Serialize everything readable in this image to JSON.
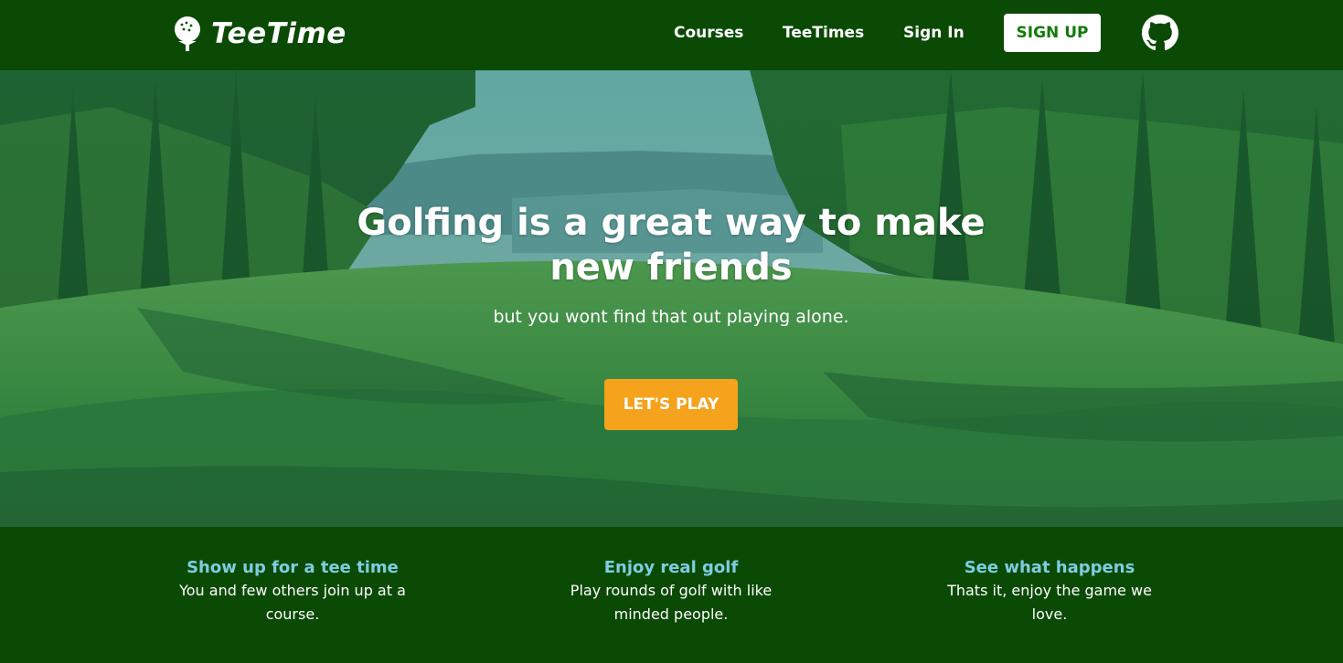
{
  "brand": {
    "name": "TeeTime",
    "icon": "golf-ball-on-tee-icon"
  },
  "nav": {
    "links": [
      "Courses",
      "TeeTimes",
      "Sign In"
    ],
    "signup_label": "SIGN UP",
    "github_icon": "github-icon"
  },
  "hero": {
    "title": "Golfing is a great way to make new friends",
    "subtitle": "but you wont find that out playing alone.",
    "cta_label": "LET'S PLAY"
  },
  "features": [
    {
      "title": "Show up for a tee time",
      "text": "You and few others join up at a course."
    },
    {
      "title": "Enjoy real golf",
      "text": "Play rounds of golf with like minded people."
    },
    {
      "title": "See what happens",
      "text": "Thats it, enjoy the game we love."
    }
  ],
  "colors": {
    "nav_bg": "#0b4a05",
    "signup_text": "#157a0c",
    "cta_bg": "#f5a21d",
    "feature_title": "#7fcde0"
  }
}
